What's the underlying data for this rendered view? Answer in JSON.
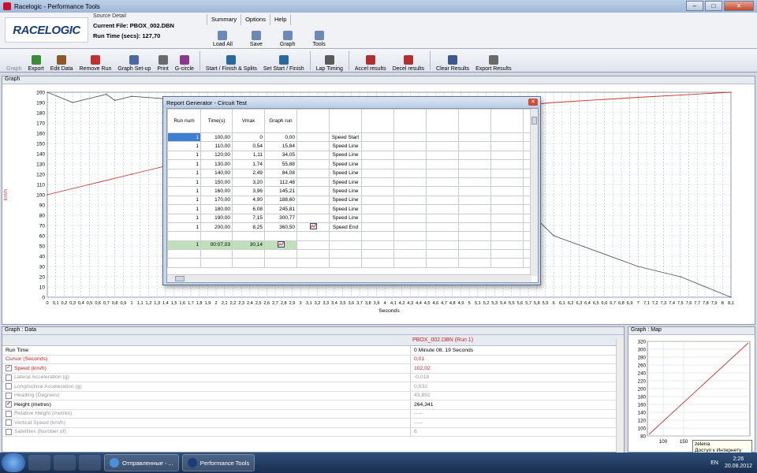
{
  "window": {
    "title": "Racelogic - Performance Tools",
    "min": "–",
    "max": "□",
    "close": "✕"
  },
  "header": {
    "logo": "RACELOGIC",
    "source_detail": "Source Detail",
    "current_file": "Current File: PBOX_002.DBN",
    "run_time": "Run Time (secs): 127,70",
    "menu": [
      "Summary",
      "Options",
      "Help"
    ],
    "ribbon_top": [
      {
        "label": "Load All",
        "icon": "folder-icon"
      },
      {
        "label": "Save",
        "icon": "save-icon"
      },
      {
        "label": "Graph",
        "icon": "graph-icon"
      },
      {
        "label": "Tools",
        "icon": "tools-icon"
      }
    ]
  },
  "toolbar": {
    "graph_label": "Graph",
    "buttons": [
      {
        "label": "Export",
        "icon": "export-icon",
        "color": "#3a8a3a"
      },
      {
        "label": "Edit Data",
        "icon": "edit-data-icon",
        "color": "#8a5a2a"
      },
      {
        "label": "Remove Run",
        "icon": "remove-run-icon",
        "color": "#c03030"
      },
      {
        "label": "Graph Set-up",
        "icon": "graph-setup-icon",
        "color": "#4a6aa0"
      },
      {
        "label": "Print",
        "icon": "print-icon",
        "color": "#6a6a6a"
      },
      {
        "label": "G-circle",
        "icon": "g-circle-icon",
        "color": "#8a3a8a"
      },
      {
        "label": "Start / Finish & Splits",
        "icon": "start-finish-splits-icon",
        "color": "#2a6a9a"
      },
      {
        "label": "Set Start / Finish",
        "icon": "set-start-finish-icon",
        "color": "#2a6a9a"
      },
      {
        "label": "Lap Timing",
        "icon": "lap-timing-icon",
        "color": "#5a5a5a"
      },
      {
        "label": "Accel results",
        "icon": "accel-results-icon",
        "color": "#b03030"
      },
      {
        "label": "Decel results",
        "icon": "decel-results-icon",
        "color": "#b03030"
      },
      {
        "label": "Clear Results",
        "icon": "clear-results-icon",
        "color": "#3a5a8a"
      },
      {
        "label": "Export Results",
        "icon": "export-results-icon",
        "color": "#6a6a6a"
      }
    ]
  },
  "graph": {
    "title": "Graph",
    "ylabel": "km/h",
    "xlabel": "Seconds",
    "y_ticks": [
      200,
      190,
      180,
      170,
      160,
      150,
      140,
      130,
      120,
      110,
      100,
      90,
      80,
      70,
      60,
      50,
      40,
      30,
      20,
      10,
      0
    ],
    "x_ticks": [
      "0",
      "0,1",
      "0,2",
      "0,3",
      "0,4",
      "0,5",
      "0,6",
      "0,7",
      "0,8",
      "0,9",
      "1",
      "1,1",
      "1,2",
      "1,3",
      "1,4",
      "1,5",
      "1,6",
      "1,7",
      "1,8",
      "1,9",
      "2",
      "2,1",
      "2,2",
      "2,3",
      "2,4",
      "2,5",
      "2,6",
      "2,7",
      "2,8",
      "2,9",
      "3",
      "3,1",
      "3,2",
      "3,3",
      "3,4",
      "3,5",
      "3,6",
      "3,7",
      "3,8",
      "3,9",
      "4",
      "4,1",
      "4,2",
      "4,3",
      "4,4",
      "4,5",
      "4,6",
      "4,7",
      "4,8",
      "4,9",
      "5",
      "5,1",
      "5,2",
      "5,3",
      "5,4",
      "5,5",
      "5,6",
      "5,7",
      "5,8",
      "5,9",
      "6",
      "6,1",
      "6,2",
      "6,3",
      "6,4",
      "6,5",
      "6,6",
      "6,7",
      "6,8",
      "6,9",
      "7",
      "7,1",
      "7,2",
      "7,3",
      "7,4",
      "7,5",
      "7,6",
      "7,7",
      "7,8",
      "7,9",
      "8",
      "8,1"
    ],
    "line_color_speed": "#c0392b",
    "line_color_height": "#555555"
  },
  "chart_data": {
    "type": "line",
    "title": "",
    "xlabel": "Seconds",
    "ylabel": "km/h",
    "ylim": [
      0,
      200
    ],
    "xlim": [
      0,
      8.1
    ],
    "series": [
      {
        "color": "#c0392b",
        "x": [
          0,
          0.5,
          1,
          1.5,
          2,
          3,
          4,
          5,
          6,
          7,
          8.1
        ],
        "values": [
          100,
          110,
          120,
          130,
          140,
          160,
          172,
          182,
          190,
          195,
          200
        ]
      },
      {
        "color": "#555555",
        "x": [
          0,
          0.3,
          0.7,
          0.8,
          1.0,
          2.0,
          3.0,
          4.0,
          5.0,
          6.0,
          7.0,
          7.5,
          8.1
        ],
        "values": [
          200,
          190,
          198,
          192,
          196,
          190,
          182,
          170,
          140,
          60,
          30,
          20,
          0
        ]
      }
    ]
  },
  "dialog": {
    "title": "Report Generator - Circuit Test",
    "headers": [
      "Run num",
      "Time(s)",
      "Vmax",
      "Graph run",
      "",
      "",
      "",
      "",
      "",
      "",
      "",
      ""
    ],
    "rows": [
      [
        "1",
        "100,00",
        "0",
        "0,00",
        "",
        "Speed Start"
      ],
      [
        "1",
        "110,00",
        "0,54",
        "15,84",
        "",
        "Speed Line"
      ],
      [
        "1",
        "120,00",
        "1,11",
        "34,05",
        "",
        "Speed Line"
      ],
      [
        "1",
        "130,00",
        "1,74",
        "55,88",
        "",
        "Speed Line"
      ],
      [
        "1",
        "140,00",
        "2,49",
        "84,08",
        "",
        "Speed Line"
      ],
      [
        "1",
        "150,00",
        "3,20",
        "112,48",
        "",
        "Speed Line"
      ],
      [
        "1",
        "160,00",
        "3,96",
        "145,21",
        "",
        "Speed Line"
      ],
      [
        "1",
        "170,00",
        "4,90",
        "188,60",
        "",
        "Speed Line"
      ],
      [
        "1",
        "180,00",
        "6,08",
        "245,81",
        "",
        "Speed Line"
      ],
      [
        "1",
        "190,00",
        "7,15",
        "300,77",
        "",
        "Speed Line"
      ],
      [
        "1",
        "200,00",
        "8,25",
        "360,50",
        "chart-icon",
        "Speed End"
      ]
    ],
    "summary": [
      "1",
      "00:07,03",
      "30,14",
      "chart-icon"
    ]
  },
  "data_panel": {
    "title": "Graph : Data",
    "run_label": "PBOX_002.DBN (Run 1)",
    "rows": [
      {
        "name": "Run Time",
        "value": "0 Minute 08. 19 Seconds",
        "style": "plain",
        "check": "none"
      },
      {
        "name": "Cursor (Seconds)",
        "value": "0,01",
        "style": "red",
        "check": "none"
      },
      {
        "name": "Speed (km/h)",
        "value": "102,02",
        "style": "red",
        "check": "checked"
      },
      {
        "name": "Lateral Acceleration (g)",
        "value": "-0,018",
        "style": "grey",
        "check": "unchecked"
      },
      {
        "name": "Longitudinal Acceleration (g)",
        "value": "0,532",
        "style": "grey",
        "check": "unchecked"
      },
      {
        "name": "Heading (Degrees)",
        "value": "43,891",
        "style": "grey",
        "check": "unchecked"
      },
      {
        "name": "Height (metres)",
        "value": "264,341",
        "style": "plain",
        "check": "checked"
      },
      {
        "name": "Relative Height (metres)",
        "value": "-----",
        "style": "grey",
        "check": "unchecked"
      },
      {
        "name": "Vertical Speed (km/h)",
        "value": "-----",
        "style": "grey",
        "check": "unchecked"
      },
      {
        "name": "Satellites (Number of)",
        "value": "6",
        "style": "grey",
        "check": "unchecked"
      }
    ]
  },
  "map_panel": {
    "title": "Graph : Map",
    "y_ticks": [
      "320",
      "300",
      "280",
      "260",
      "240",
      "220",
      "200",
      "180",
      "160",
      "140",
      "120",
      "100",
      "80"
    ],
    "x_ticks": [
      "100",
      "150"
    ],
    "line_color": "#c0392b"
  },
  "tooltip": {
    "line1": "zelena",
    "line2": "Доступ к Интернету"
  },
  "taskbar": {
    "apps": [
      {
        "label": "Отправленные - ...",
        "icon": "chrome-icon"
      },
      {
        "label": "Performance Tools",
        "icon": "racelogic-icon"
      }
    ],
    "lang": "EN",
    "time": "2:26",
    "date": "20.08.2012"
  }
}
